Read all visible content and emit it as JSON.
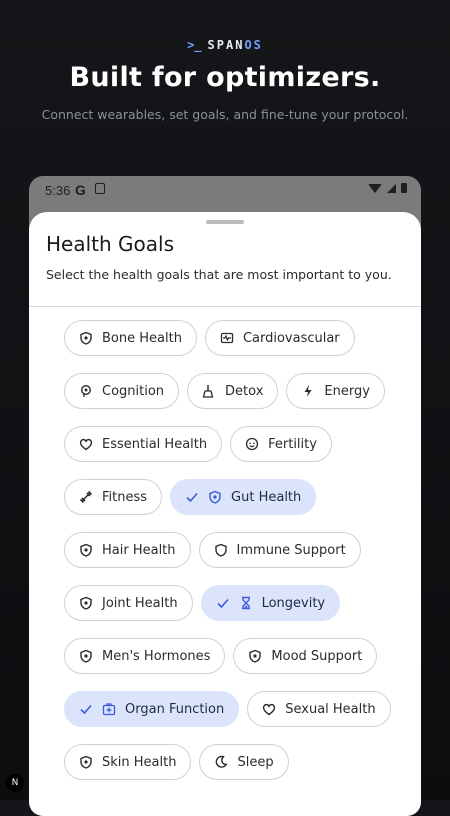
{
  "brand": {
    "prompt": ">_",
    "name_part1": "SPAN",
    "name_part2": "OS"
  },
  "hero": {
    "headline": "Built for optimizers.",
    "subline": "Connect wearables, set goals, and fine-tune your protocol."
  },
  "status_bar": {
    "time": "5:36",
    "g_label": "G"
  },
  "sheet": {
    "title": "Health Goals",
    "subtitle": "Select the health goals that are most important to you."
  },
  "goals": [
    {
      "label": "Bone Health",
      "icon": "shield-icon",
      "selected": false
    },
    {
      "label": "Cardiovascular",
      "icon": "heart-monitor-icon",
      "selected": false
    },
    {
      "label": "Cognition",
      "icon": "brain-icon",
      "selected": false
    },
    {
      "label": "Detox",
      "icon": "broom-icon",
      "selected": false
    },
    {
      "label": "Energy",
      "icon": "bolt-icon",
      "selected": false
    },
    {
      "label": "Essential Health",
      "icon": "heart-icon",
      "selected": false
    },
    {
      "label": "Fertility",
      "icon": "fertility-icon",
      "selected": false
    },
    {
      "label": "Fitness",
      "icon": "dumbbell-icon",
      "selected": false
    },
    {
      "label": "Gut Health",
      "icon": "shield-icon",
      "selected": true
    },
    {
      "label": "Hair Health",
      "icon": "shield-icon",
      "selected": false
    },
    {
      "label": "Immune Support",
      "icon": "shield-outline-icon",
      "selected": false
    },
    {
      "label": "Joint Health",
      "icon": "shield-icon",
      "selected": false
    },
    {
      "label": "Longevity",
      "icon": "hourglass-icon",
      "selected": true
    },
    {
      "label": "Men's Hormones",
      "icon": "shield-icon",
      "selected": false
    },
    {
      "label": "Mood Support",
      "icon": "shield-icon",
      "selected": false
    },
    {
      "label": "Organ Function",
      "icon": "medical-kit-icon",
      "selected": true
    },
    {
      "label": "Sexual Health",
      "icon": "heart-icon",
      "selected": false
    },
    {
      "label": "Skin Health",
      "icon": "shield-icon",
      "selected": false
    },
    {
      "label": "Sleep",
      "icon": "moon-icon",
      "selected": false
    }
  ],
  "badge": {
    "label": "N"
  },
  "colors": {
    "accent": "#6ea2ff",
    "selected_chip": "#dbe4fb",
    "selected_icon": "#3b5bdb"
  }
}
